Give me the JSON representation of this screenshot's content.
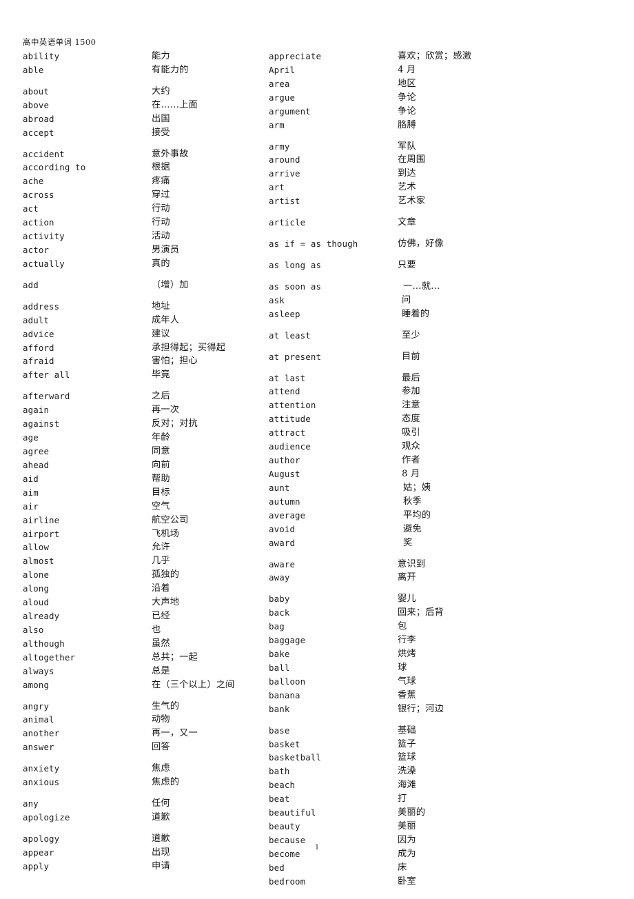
{
  "document": {
    "title": "高中英语单词 1500",
    "page_number": "1"
  },
  "columns": [
    {
      "name": "left-column",
      "entries": [
        {
          "en": "ability",
          "zh": "能力",
          "gap": false,
          "indent": 0
        },
        {
          "en": "able",
          "zh": "有能力的",
          "gap": false,
          "indent": 0
        },
        {
          "en": "about",
          "zh": "大约",
          "gap": true,
          "indent": 0
        },
        {
          "en": "above",
          "zh": "在……上面",
          "gap": false,
          "indent": 0
        },
        {
          "en": "abroad",
          "zh": "出国",
          "gap": false,
          "indent": 0
        },
        {
          "en": "accept",
          "zh": "接受",
          "gap": false,
          "indent": 0
        },
        {
          "en": "accident",
          "zh": "意外事故",
          "gap": true,
          "indent": 0
        },
        {
          "en": "according to",
          "zh": "根据",
          "gap": false,
          "indent": 0
        },
        {
          "en": "ache",
          "zh": "疼痛",
          "gap": false,
          "indent": 0
        },
        {
          "en": "across",
          "zh": "穿过",
          "gap": false,
          "indent": 0
        },
        {
          "en": "act",
          "zh": "行动",
          "gap": false,
          "indent": 0
        },
        {
          "en": "action",
          "zh": "行动",
          "gap": false,
          "indent": 0
        },
        {
          "en": "activity",
          "zh": "活动",
          "gap": false,
          "indent": 0
        },
        {
          "en": "actor",
          "zh": "男演员",
          "gap": false,
          "indent": 0
        },
        {
          "en": "actually",
          "zh": "真的",
          "gap": false,
          "indent": 0
        },
        {
          "en": "add",
          "zh": "（增）加",
          "gap": true,
          "indent": 0
        },
        {
          "en": "address",
          "zh": "地址",
          "gap": true,
          "indent": 0
        },
        {
          "en": "adult",
          "zh": "成年人",
          "gap": false,
          "indent": 0
        },
        {
          "en": "advice",
          "zh": "建议",
          "gap": false,
          "indent": 0
        },
        {
          "en": "afford",
          "zh": "承担得起；买得起",
          "gap": false,
          "indent": 0
        },
        {
          "en": "afraid",
          "zh": "害怕；担心",
          "gap": false,
          "indent": 0
        },
        {
          "en": "after all",
          "zh": "毕竟",
          "gap": false,
          "indent": 0
        },
        {
          "en": "afterward",
          "zh": "之后",
          "gap": true,
          "indent": 0
        },
        {
          "en": "again",
          "zh": "再一次",
          "gap": false,
          "indent": 0
        },
        {
          "en": "against",
          "zh": "反对；对抗",
          "gap": false,
          "indent": 0
        },
        {
          "en": "age",
          "zh": "年龄",
          "gap": false,
          "indent": 0
        },
        {
          "en": "agree",
          "zh": "同意",
          "gap": false,
          "indent": 0
        },
        {
          "en": "ahead",
          "zh": "向前",
          "gap": false,
          "indent": 0
        },
        {
          "en": "aid",
          "zh": "帮助",
          "gap": false,
          "indent": 0
        },
        {
          "en": "aim",
          "zh": "目标",
          "gap": false,
          "indent": 0
        },
        {
          "en": "air",
          "zh": "空气",
          "gap": false,
          "indent": 0
        },
        {
          "en": "airline",
          "zh": "航空公司",
          "gap": false,
          "indent": 0
        },
        {
          "en": "airport",
          "zh": "飞机场",
          "gap": false,
          "indent": 0
        },
        {
          "en": "allow",
          "zh": "允许",
          "gap": false,
          "indent": 0
        },
        {
          "en": "almost",
          "zh": "几乎",
          "gap": false,
          "indent": 0
        },
        {
          "en": "alone",
          "zh": "孤独的",
          "gap": false,
          "indent": 0
        },
        {
          "en": "along",
          "zh": "沿着",
          "gap": false,
          "indent": 0
        },
        {
          "en": "aloud",
          "zh": "大声地",
          "gap": false,
          "indent": 0
        },
        {
          "en": "already",
          "zh": "已经",
          "gap": false,
          "indent": 0
        },
        {
          "en": "also",
          "zh": "也",
          "gap": false,
          "indent": 0
        },
        {
          "en": "although",
          "zh": "虽然",
          "gap": false,
          "indent": 0
        },
        {
          "en": "altogether",
          "zh": "总共；一起",
          "gap": false,
          "indent": 0
        },
        {
          "en": "always",
          "zh": "总是",
          "gap": false,
          "indent": 0
        },
        {
          "en": "among",
          "zh": "在（三个以上）之间",
          "gap": false,
          "indent": 0
        },
        {
          "en": "angry",
          "zh": "生气的",
          "gap": true,
          "indent": 0
        },
        {
          "en": "animal",
          "zh": "动物",
          "gap": false,
          "indent": 0
        },
        {
          "en": "another",
          "zh": "再一，又一",
          "gap": false,
          "indent": 0
        },
        {
          "en": "answer",
          "zh": "回答",
          "gap": false,
          "indent": 0
        },
        {
          "en": "anxiety",
          "zh": "焦虑",
          "gap": true,
          "indent": 0
        },
        {
          "en": "anxious",
          "zh": "焦虑的",
          "gap": false,
          "indent": 0
        },
        {
          "en": "any",
          "zh": "任何",
          "gap": true,
          "indent": 0
        },
        {
          "en": "apologize",
          "zh": "道歉",
          "gap": false,
          "indent": 0
        },
        {
          "en": "apology",
          "zh": "道歉",
          "gap": true,
          "indent": 0
        },
        {
          "en": "appear",
          "zh": "出现",
          "gap": false,
          "indent": 0
        },
        {
          "en": "apply",
          "zh": "申请",
          "gap": false,
          "indent": 0
        }
      ]
    },
    {
      "name": "right-column",
      "entries": [
        {
          "en": "appreciate",
          "zh": "喜欢；欣赏；感激",
          "gap": false,
          "indent": 0
        },
        {
          "en": "April",
          "zh": "4 月",
          "gap": false,
          "indent": 0
        },
        {
          "en": "area",
          "zh": "地区",
          "gap": false,
          "indent": 0
        },
        {
          "en": "argue",
          "zh": "争论",
          "gap": false,
          "indent": 0
        },
        {
          "en": "argument",
          "zh": "争论",
          "gap": false,
          "indent": 0
        },
        {
          "en": "arm",
          "zh": "胳膊",
          "gap": false,
          "indent": 0
        },
        {
          "en": "army",
          "zh": "军队",
          "gap": true,
          "indent": 0
        },
        {
          "en": "around",
          "zh": "在周围",
          "gap": false,
          "indent": 0
        },
        {
          "en": "arrive",
          "zh": "到达",
          "gap": false,
          "indent": 0
        },
        {
          "en": "art",
          "zh": "艺术",
          "gap": false,
          "indent": 0
        },
        {
          "en": "artist",
          "zh": "艺术家",
          "gap": false,
          "indent": 0
        },
        {
          "en": "article",
          "zh": "文章",
          "gap": true,
          "indent": 0
        },
        {
          "en": "as if = as though",
          "zh": "仿佛，好像",
          "gap": true,
          "indent": 0
        },
        {
          "en": "as long as",
          "zh": "只要",
          "gap": true,
          "indent": 0
        },
        {
          "en": "as soon as",
          "zh": "一…就…",
          "gap": true,
          "indent": 2
        },
        {
          "en": "ask",
          "zh": "问",
          "gap": false,
          "indent": 1
        },
        {
          "en": "asleep",
          "zh": "睡着的",
          "gap": false,
          "indent": 1
        },
        {
          "en": "at least",
          "zh": "至少",
          "gap": true,
          "indent": 1
        },
        {
          "en": "at present",
          "zh": "目前",
          "gap": true,
          "indent": 1
        },
        {
          "en": "at last",
          "zh": "最后",
          "gap": true,
          "indent": 1
        },
        {
          "en": "attend",
          "zh": "参加",
          "gap": false,
          "indent": 1
        },
        {
          "en": "attention",
          "zh": "注意",
          "gap": false,
          "indent": 1
        },
        {
          "en": "attitude",
          "zh": "态度",
          "gap": false,
          "indent": 1
        },
        {
          "en": "attract",
          "zh": "吸引",
          "gap": false,
          "indent": 1
        },
        {
          "en": "audience",
          "zh": "观众",
          "gap": false,
          "indent": 1
        },
        {
          "en": "author",
          "zh": "作者",
          "gap": false,
          "indent": 1
        },
        {
          "en": "August",
          "zh": "8 月",
          "gap": false,
          "indent": 1
        },
        {
          "en": "aunt",
          "zh": "姑；姨",
          "gap": false,
          "indent": 2
        },
        {
          "en": "autumn",
          "zh": "秋季",
          "gap": false,
          "indent": 2
        },
        {
          "en": "average",
          "zh": "平均的",
          "gap": false,
          "indent": 2
        },
        {
          "en": "avoid",
          "zh": "避免",
          "gap": false,
          "indent": 2
        },
        {
          "en": "award",
          "zh": "奖",
          "gap": false,
          "indent": 2
        },
        {
          "en": "aware",
          "zh": "意识到",
          "gap": true,
          "indent": 0
        },
        {
          "en": "away",
          "zh": "离开",
          "gap": false,
          "indent": 0
        },
        {
          "en": "baby",
          "zh": "婴儿",
          "gap": true,
          "indent": 0
        },
        {
          "en": "back",
          "zh": "回来；后背",
          "gap": false,
          "indent": 0
        },
        {
          "en": "bag",
          "zh": "包",
          "gap": false,
          "indent": 0
        },
        {
          "en": "baggage",
          "zh": "行李",
          "gap": false,
          "indent": 0
        },
        {
          "en": "bake",
          "zh": "烘烤",
          "gap": false,
          "indent": 0
        },
        {
          "en": "ball",
          "zh": "球",
          "gap": false,
          "indent": 0
        },
        {
          "en": "balloon",
          "zh": "气球",
          "gap": false,
          "indent": 0
        },
        {
          "en": "banana",
          "zh": "香蕉",
          "gap": false,
          "indent": 0
        },
        {
          "en": "bank",
          "zh": "银行；河边",
          "gap": false,
          "indent": 0
        },
        {
          "en": "base",
          "zh": "基础",
          "gap": true,
          "indent": 0
        },
        {
          "en": "basket",
          "zh": "篮子",
          "gap": false,
          "indent": 0
        },
        {
          "en": "basketball",
          "zh": "篮球",
          "gap": false,
          "indent": 0
        },
        {
          "en": "bath",
          "zh": "洗澡",
          "gap": false,
          "indent": 0
        },
        {
          "en": "beach",
          "zh": "海滩",
          "gap": false,
          "indent": 0
        },
        {
          "en": "beat",
          "zh": "打",
          "gap": false,
          "indent": 0
        },
        {
          "en": "beautiful",
          "zh": "美丽的",
          "gap": false,
          "indent": 0
        },
        {
          "en": "beauty",
          "zh": "美丽",
          "gap": false,
          "indent": 0
        },
        {
          "en": "because",
          "zh": "因为",
          "gap": false,
          "indent": 0
        },
        {
          "en": "become",
          "zh": "成为",
          "gap": false,
          "indent": 0
        },
        {
          "en": "bed",
          "zh": "床",
          "gap": false,
          "indent": 0
        },
        {
          "en": "bedroom",
          "zh": "卧室",
          "gap": false,
          "indent": 0
        }
      ]
    }
  ]
}
